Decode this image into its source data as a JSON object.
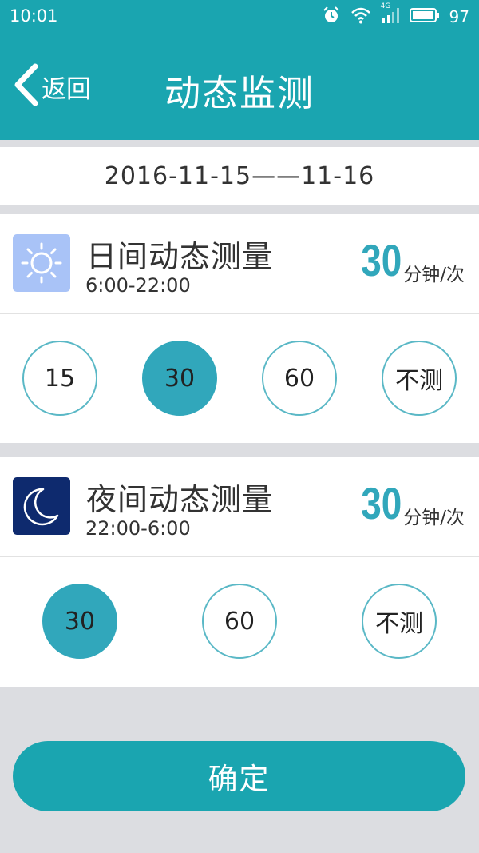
{
  "status_bar": {
    "time": "10:01",
    "battery": "97",
    "network": "4G",
    "icons": [
      "alarm-icon",
      "wifi-icon",
      "signal-icon",
      "battery-icon"
    ]
  },
  "header": {
    "back_label": "返回",
    "title": "动态监测"
  },
  "date_range": "2016-11-15——11-16",
  "day": {
    "title": "日间动态测量",
    "time_range": "6:00-22:00",
    "frequency": "30",
    "unit": "分钟/次",
    "icon": "sun-icon",
    "options": [
      "15",
      "30",
      "60",
      "不测"
    ],
    "selected": "30"
  },
  "night": {
    "title": "夜间动态测量",
    "time_range": "22:00-6:00",
    "frequency": "30",
    "unit": "分钟/次",
    "icon": "moon-icon",
    "options": [
      "30",
      "60",
      "不测"
    ],
    "selected": "30"
  },
  "confirm_label": "确定",
  "colors": {
    "brand": "#1aa5b0",
    "accent": "#31a7bb",
    "option_border": "#5ab8c6",
    "day_icon_bg": "#a9c3f7",
    "night_icon_bg": "#0e2a6e"
  }
}
